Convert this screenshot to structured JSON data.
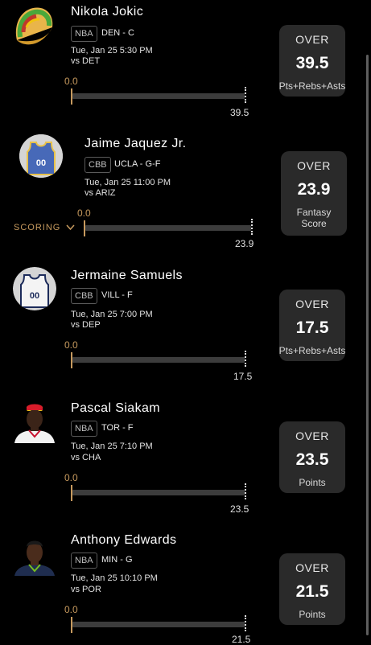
{
  "scroll_hint": "SCORING",
  "players": [
    {
      "name": "Nikola Jokic",
      "league": "NBA",
      "team_pos": "DEN - C",
      "game_time": "Tue, Jan 25 5:30 PM",
      "opponent": "vs DET",
      "progress_start": "0.0",
      "progress_end": "39.5",
      "over_under": "OVER",
      "line": "39.5",
      "stat": "Pts+Rebs+Asts",
      "avatar": "taco-icon"
    },
    {
      "name": "Jaime Jaquez Jr.",
      "league": "CBB",
      "team_pos": "UCLA - G-F",
      "game_time": "Tue, Jan 25 11:00 PM",
      "opponent": "vs ARIZ",
      "progress_start": "0.0",
      "progress_end": "23.9",
      "over_under": "OVER",
      "line": "23.9",
      "stat": "Fantasy Score",
      "avatar": "jersey-icon-blue"
    },
    {
      "name": "Jermaine Samuels",
      "league": "CBB",
      "team_pos": "VILL - F",
      "game_time": "Tue, Jan 25 7:00 PM",
      "opponent": "vs DEP",
      "progress_start": "0.0",
      "progress_end": "17.5",
      "over_under": "OVER",
      "line": "17.5",
      "stat": "Pts+Rebs+Asts",
      "avatar": "jersey-icon-white"
    },
    {
      "name": "Pascal Siakam",
      "league": "NBA",
      "team_pos": "TOR - F",
      "game_time": "Tue, Jan 25 7:10 PM",
      "opponent": "vs CHA",
      "progress_start": "0.0",
      "progress_end": "23.5",
      "over_under": "OVER",
      "line": "23.5",
      "stat": "Points",
      "avatar": "player-photo"
    },
    {
      "name": "Anthony Edwards",
      "league": "NBA",
      "team_pos": "MIN - G",
      "game_time": "Tue, Jan 25 10:10 PM",
      "opponent": "vs POR",
      "progress_start": "0.0",
      "progress_end": "21.5",
      "over_under": "OVER",
      "line": "21.5",
      "stat": "Points",
      "avatar": "player-photo"
    }
  ]
}
